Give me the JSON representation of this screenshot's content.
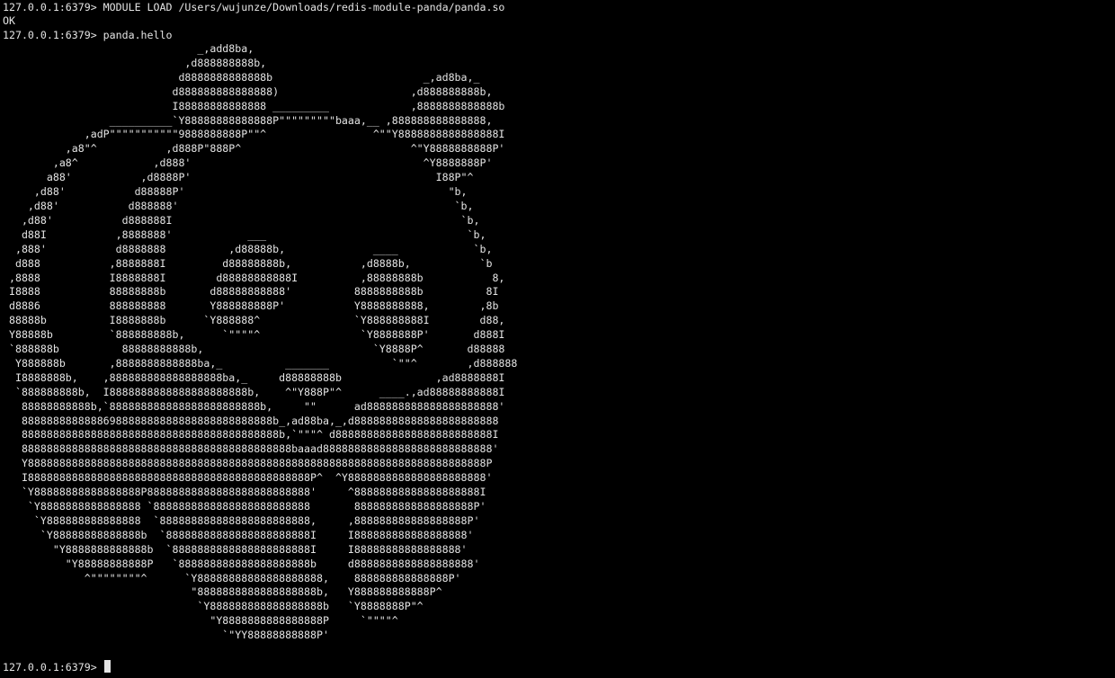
{
  "terminal": {
    "lines": [
      "127.0.0.1:6379> MODULE LOAD /Users/wujunze/Downloads/redis-module-panda/panda.so",
      "OK",
      "127.0.0.1:6379> panda.hello"
    ],
    "panda_art": "                               _,add8ba,\n                             ,d888888888b,\n                            d8888888888888b                        _,ad8ba,_\n                           d888888888888888)                     ,d888888888b,\n                           I88888888888888 _________             ,8888888888888b\n                 __________`Y88888888888888P\"\"\"\"\"\"\"\"\"baaa,__ ,888888888888888,\n             ,adP\"\"\"\"\"\"\"\"\"\"\"9888888888P\"\"^                 ^\"\"Y8888888888888888I\n          ,a8\"^           ,d888P\"888P^                           ^\"Y8888888888P'\n        ,a8^            ,d888'                                     ^Y8888888P'\n       a88'           ,d8888P'                                       I88P\"^\n     ,d88'           d88888P'                                          \"b,\n    ,d88'           d888888'                                            `b,\n   ,d88'           d888888I                                              `b,\n   d88I           ,8888888'            ___                                `b,\n  ,888'           d8888888          ,d88888b,              ____            `b,\n  d888           ,8888888I         d88888888b,           ,d8888b,           `b\n ,8888           I8888888I        d88888888888I          ,88888888b           8,\n I8888           88888888b       d88888888888'          8888888888b          8I\n d8886           888888888       Y888888888P'           Y8888888888,        ,8b\n 88888b          I8888888b      `Y888888^               `Y888888888I        d88,\n Y88888b         `888888888b,      `\"\"\"\"^                `Y8888888P'       d888I\n `888888b          88888888888b,                           `Y8888P^       d88888\n  Y888888b       ,8888888888888ba,_          _______          `\"\"^        ,d888888\n  I8888888b,    ,888888888888888888ba,_     d88888888b               ,ad8888888I\n  `888888888b,  I8888888888888888888888b,    ^\"Y888P\"^      ____.,ad88888888888I\n   88888888888b,`888888888888888888888888b,     \"\"      ad888888888888888888888'\n   8888888888888698888888888888888888888888b_,ad88ba,_,d88888888888888888888888\n   88888888888888888888888888888888888888888b,`\"\"\"^ d8888888888888888888888888I\n   8888888888888888888888888888888888888888888baaad888888888888888888888888888'\n   Y8888888888888888888888888888888888888888888888888888888888888888888888888P\n   I888888888888888888888888888888888888888888888P^  ^Y8888888888888888888888'\n   `Y88888888888888888P88888888888888888888888888'     ^88888888888888888888I\n    `Y8888888888888888 `8888888888888888888888888       8888888888888888888P'\n     `Y888888888888888  `888888888888888888888888,     ,888888888888888888P'\n      `Y88888888888888b  `88888888888888888888888I     I888888888888888888'\n        \"Y8888888888888b  `8888888888888888888888I     I88888888888888888'\n          \"Y88888888888P   `888888888888888888888b     d8888888888888888888'\n             ^\"\"\"\"\"\"\"\"^      `Y88888888888888888888,    888888888888888P'\n                              \"8888888888888888888b,   Y888888888888P^\n                               `Y888888888888888888b   `Y8888888P\"^\n                                 \"Y8888888888888888P     `\"\"\"\"^\n                                   `\"YY88888888888P'",
    "prompt": "127.0.0.1:6379> "
  }
}
